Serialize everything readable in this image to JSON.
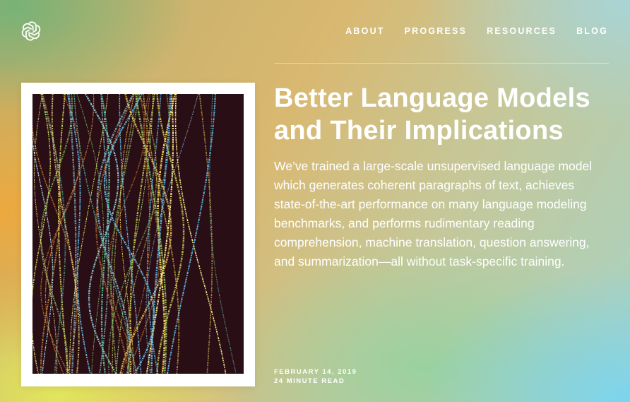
{
  "header": {
    "logo_icon": "openai-logo-icon",
    "nav": [
      {
        "label": "ABOUT"
      },
      {
        "label": "PROGRESS"
      },
      {
        "label": "RESOURCES"
      },
      {
        "label": "BLOG"
      }
    ]
  },
  "article": {
    "title": "Better Language Models and Their Implications",
    "summary": "We’ve trained a large-scale unsupervised language model which generates coherent paragraphs of text, achieves state-of-the-art performance on many language modeling benchmarks, and performs rudimentary reading comprehension, machine translation, question answering, and summarization—all without task-specific training.",
    "date": "FEBRUARY 14, 2019",
    "read_time": "24 MINUTE READ"
  },
  "colors": {
    "text": "#ffffff",
    "card_background": "#ffffff",
    "art_background": "#2a0e15"
  }
}
